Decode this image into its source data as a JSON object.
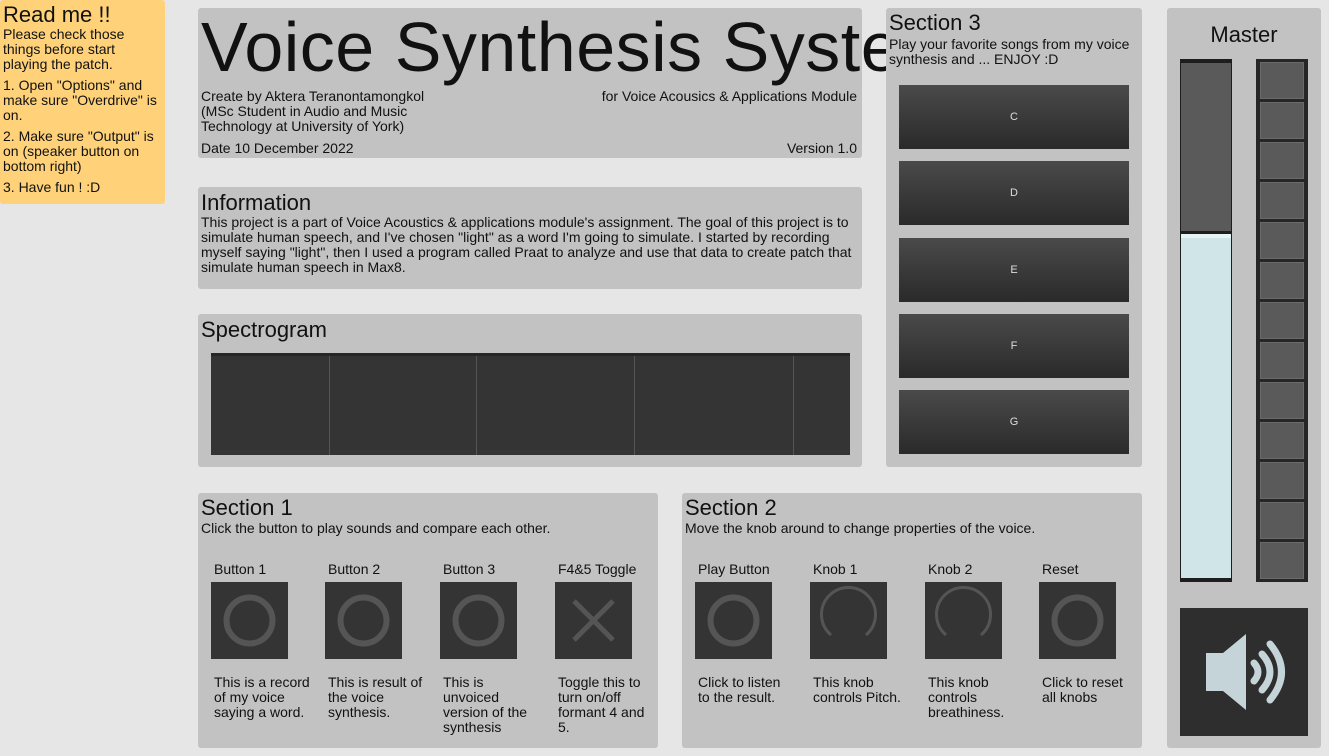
{
  "readme": {
    "title": "Read me !!",
    "intro": "Please check those things before start playing the patch.",
    "steps": [
      "1. Open \"Options\" and make sure \"Overdrive\" is on.",
      "2. Make sure \"Output\" is on (speaker button on bottom right)",
      "3. Have fun ! :D"
    ]
  },
  "header": {
    "title": "Voice Synthesis System",
    "author": "Create by Aktera Teranontamongkol (MSc Student in Audio and Music Technology at University of York)",
    "module": "for Voice Acousics & Applications Module",
    "date": "Date 10 December 2022",
    "version": "Version 1.0"
  },
  "info": {
    "title": "Information",
    "body": "This project is a part of Voice Acoustics & applications module's assignment. The goal of this project is to simulate human speech, and I've chosen \"light\" as a word I'm going to simulate. I started by recording myself saying \"light\", then I used a program called Praat to analyze and use that data to create patch that simulate human speech in Max8."
  },
  "spectrogram": {
    "title": "Spectrogram"
  },
  "section3": {
    "title": "Section 3",
    "subtitle": "Play your favorite songs from my voice synthesis and ... ENJOY :D",
    "keys": [
      "C",
      "D",
      "E",
      "F",
      "G"
    ]
  },
  "master": {
    "title": "Master",
    "level": 0.66,
    "meter_segments": 13,
    "speaker_icon": "speaker-volume-icon"
  },
  "section1": {
    "title": "Section 1",
    "subtitle": "Click the button to play sounds and compare each other.",
    "controls": [
      {
        "label": "Button 1",
        "icon": "circle-icon",
        "desc": "This is a record of my voice saying a word."
      },
      {
        "label": "Button 2",
        "icon": "circle-icon",
        "desc": "This is result of the voice synthesis."
      },
      {
        "label": "Button 3",
        "icon": "circle-icon",
        "desc": "This is unvoiced version of the synthesis"
      },
      {
        "label": "F4&5 Toggle",
        "icon": "x-toggle-icon",
        "desc": "Toggle this to turn on/off formant 4 and 5."
      }
    ]
  },
  "section2": {
    "title": "Section 2",
    "subtitle": "Move the knob around to change properties of the voice.",
    "controls": [
      {
        "label": "Play Button",
        "icon": "circle-icon",
        "desc": "Click to listen to the result."
      },
      {
        "label": "Knob 1",
        "icon": "knob-icon",
        "desc": "This knob controls Pitch."
      },
      {
        "label": "Knob 2",
        "icon": "knob-icon",
        "desc": "This knob controls breathiness."
      },
      {
        "label": "Reset",
        "icon": "circle-icon",
        "desc": "Click to reset all knobs"
      }
    ]
  },
  "colors": {
    "readme_bg": "#ffd27a",
    "panel": "#c2c2c2",
    "control": "#343434",
    "fader_fill": "#cfe5e8"
  }
}
